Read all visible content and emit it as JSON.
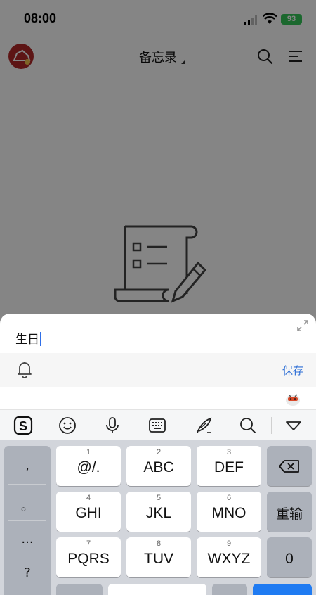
{
  "status_bar": {
    "time": "08:00",
    "battery": "93"
  },
  "header": {
    "title": "备忘录"
  },
  "sheet": {
    "input_value": "生日",
    "save_label": "保存"
  },
  "keyboard": {
    "punctuation": [
      ",",
      "。",
      "...",
      "?"
    ],
    "keys": [
      {
        "num": "1",
        "label": "@/."
      },
      {
        "num": "2",
        "label": "ABC"
      },
      {
        "num": "3",
        "label": "DEF"
      },
      {
        "num": "4",
        "label": "GHI"
      },
      {
        "num": "5",
        "label": "JKL"
      },
      {
        "num": "6",
        "label": "MNO"
      },
      {
        "num": "7",
        "label": "PQRS"
      },
      {
        "num": "8",
        "label": "TUV"
      },
      {
        "num": "9",
        "label": "WXYZ"
      }
    ],
    "reenter_label": "重输",
    "zero_label": "0"
  },
  "colors": {
    "accent": "#2e6fd6",
    "caret": "#2f6fe8",
    "battery": "#34c759",
    "brand": "#b22a2a",
    "enter_key": "#1f7bf2"
  },
  "icons": [
    "sogou-icon",
    "emoji-icon",
    "mic-icon",
    "keyboard-icon",
    "handwriting-icon",
    "search-icon",
    "collapse-keyboard-icon",
    "backspace-icon",
    "bell-icon",
    "expand-icon",
    "menu-icon",
    "wifi-icon",
    "signal-icon"
  ]
}
